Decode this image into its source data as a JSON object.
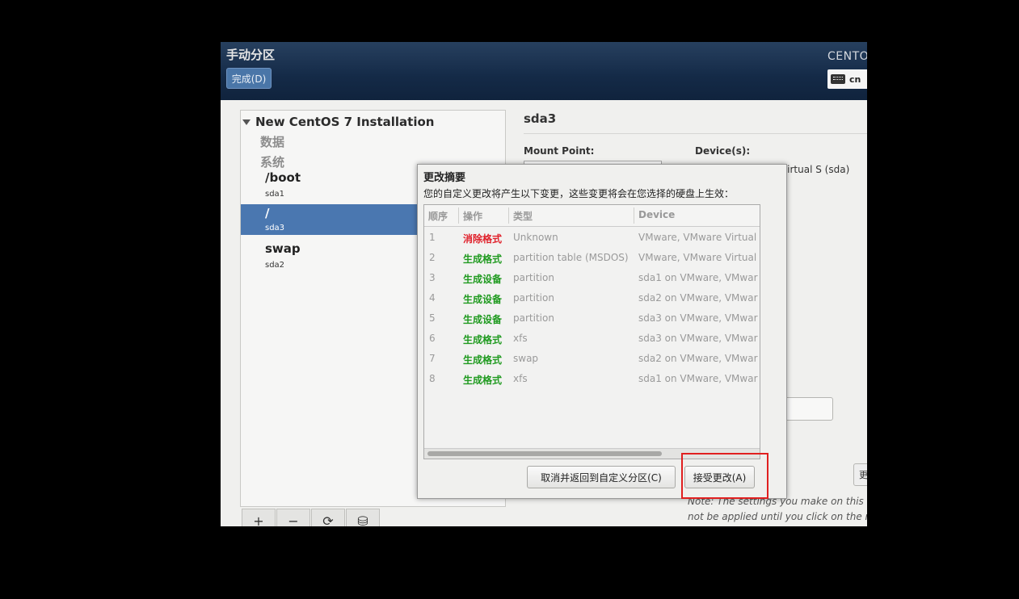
{
  "header": {
    "title": "手动分区",
    "done_button": "完成(D)",
    "brand": "CENTO",
    "keyboard_layout": "cn"
  },
  "tree": {
    "root_label": "New CentOS 7 Installation",
    "groups": [
      "数据",
      "系统"
    ],
    "mounts": [
      {
        "mount_point": "/boot",
        "device": "sda1",
        "selected": false
      },
      {
        "mount_point": "/",
        "device": "sda3",
        "selected": true
      },
      {
        "mount_point": "swap",
        "device": "sda2",
        "selected": false
      }
    ]
  },
  "toolbar": {
    "add_icon": "plus-icon",
    "remove_icon": "minus-icon",
    "refresh_icon": "refresh-icon",
    "storage_icon": "storage-icon",
    "add": "+",
    "remove": "−",
    "refresh": "⟳",
    "storage": "⛁"
  },
  "details": {
    "title": "sda3",
    "mount_point_label": "Mount Point:",
    "devices_label": "Device(s):",
    "device_text": "are Virtual S (sda)",
    "button_fragment": "更",
    "note_line1": "Note:  The settings you make on this",
    "note_line2": "not be applied until you click on the m"
  },
  "dialog": {
    "title": "更改摘要",
    "description": "您的自定义更改将产生以下变更，这些变更将会在您选择的硬盘上生效：",
    "columns": [
      "顺序",
      "操作",
      "类型",
      "Device"
    ],
    "rows": [
      {
        "order": "1",
        "action": "消除格式",
        "type": "Unknown",
        "device": "VMware, VMware Virtual",
        "action_color": "#e0202a"
      },
      {
        "order": "2",
        "action": "生成格式",
        "type": "partition table (MSDOS)",
        "device": "VMware, VMware Virtual",
        "action_color": "#1f9a1f"
      },
      {
        "order": "3",
        "action": "生成设备",
        "type": "partition",
        "device": "sda1 on VMware, VMwar",
        "action_color": "#1f9a1f"
      },
      {
        "order": "4",
        "action": "生成设备",
        "type": "partition",
        "device": "sda2 on VMware, VMwar",
        "action_color": "#1f9a1f"
      },
      {
        "order": "5",
        "action": "生成设备",
        "type": "partition",
        "device": "sda3 on VMware, VMwar",
        "action_color": "#1f9a1f"
      },
      {
        "order": "6",
        "action": "生成格式",
        "type": "xfs",
        "device": "sda3 on VMware, VMwar",
        "action_color": "#1f9a1f"
      },
      {
        "order": "7",
        "action": "生成格式",
        "type": "swap",
        "device": "sda2 on VMware, VMwar",
        "action_color": "#1f9a1f"
      },
      {
        "order": "8",
        "action": "生成格式",
        "type": "xfs",
        "device": "sda1 on VMware, VMwar",
        "action_color": "#1f9a1f"
      }
    ],
    "cancel_button": "取消并返回到自定义分区(C)",
    "accept_button": "接受更改(A)"
  },
  "colors": {
    "header_bg": "#1a3050",
    "selection": "#4a77b0",
    "highlight_box": "#e02020"
  }
}
